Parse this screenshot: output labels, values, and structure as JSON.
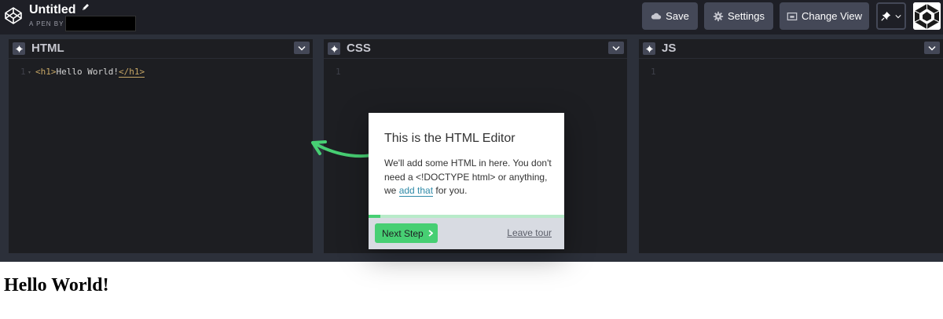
{
  "header": {
    "title": "Untitled",
    "byline": "A PEN BY",
    "buttons": {
      "save": "Save",
      "settings": "Settings",
      "change_view": "Change View"
    }
  },
  "editors": [
    {
      "title": "HTML",
      "line_number": "1",
      "code": {
        "open_tag": "<h1>",
        "text": "Hello World!",
        "close_tag": "</h1>"
      }
    },
    {
      "title": "CSS",
      "line_number": "1"
    },
    {
      "title": "JS",
      "line_number": "1"
    }
  ],
  "output": {
    "heading": "Hello World!"
  },
  "tour": {
    "title": "This is the HTML Editor",
    "body_before": "We'll add some HTML in here. You don't need a <!DOCTYPE html> or anything, we ",
    "body_link": "add that",
    "body_after": " for you.",
    "next_label": "Next Step",
    "leave_label": "Leave tour",
    "progress": 0.06
  },
  "colors": {
    "accent_green": "#47cf73",
    "header_bg": "#1e1f26",
    "button_bg": "#444857",
    "editor_bg": "#1d1e22"
  }
}
